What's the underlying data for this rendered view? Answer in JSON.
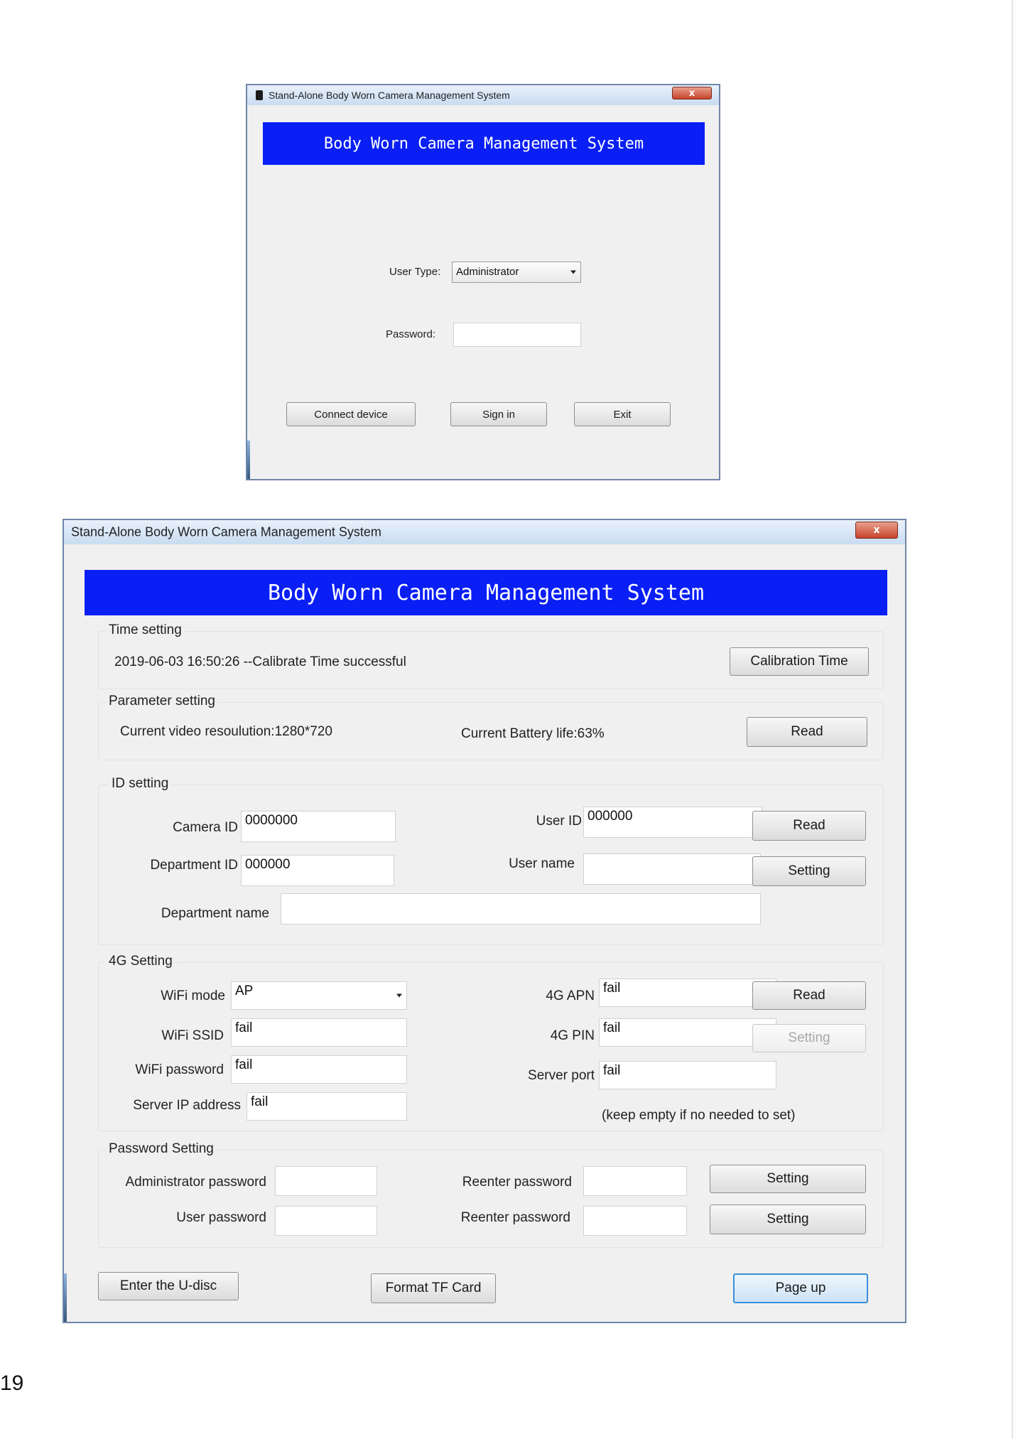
{
  "login": {
    "window_title": "Stand-Alone Body Worn Camera Management System",
    "close_glyph": "x",
    "banner": "Body Worn Camera Management System",
    "user_type_label": "User Type:",
    "user_type_value": "Administrator",
    "password_label": "Password:",
    "password_value": "",
    "connect_label": "Connect device",
    "sign_in_label": "Sign in",
    "exit_label": "Exit"
  },
  "main": {
    "window_title": "Stand-Alone Body Worn Camera Management System",
    "close_glyph": "x",
    "banner": "Body Worn Camera Management System",
    "time_setting": {
      "title": "Time setting",
      "status": "2019-06-03 16:50:26 --Calibrate Time successful",
      "button": "Calibration Time"
    },
    "parameter_setting": {
      "title": "Parameter setting",
      "resolution": "Current video resoulution:1280*720",
      "battery": "Current Battery life:63%",
      "read_button": "Read"
    },
    "id_setting": {
      "title": "ID setting",
      "camera_id_label": "Camera ID",
      "camera_id_value": "0000000",
      "user_id_label": "User ID",
      "user_id_value": "000000",
      "department_id_label": "Department ID",
      "department_id_value": "000000",
      "user_name_label": "User name",
      "user_name_value": "",
      "department_name_label": "Department name",
      "department_name_value": "",
      "read_button": "Read",
      "setting_button": "Setting"
    },
    "g4_setting": {
      "title": "4G Setting",
      "wifi_mode_label": "WiFi mode",
      "wifi_mode_value": "AP",
      "wifi_ssid_label": "WiFi SSID",
      "wifi_ssid_value": "fail",
      "wifi_password_label": "WiFi password",
      "wifi_password_value": "fail",
      "server_ip_label": "Server IP address",
      "server_ip_value": "fail",
      "apn_label": "4G APN",
      "apn_value": "fail",
      "pin_label": "4G PIN",
      "pin_value": "fail",
      "server_port_label": "Server port",
      "server_port_value": "fail",
      "note": "(keep empty if no needed to set)",
      "read_button": "Read",
      "setting_button": "Setting"
    },
    "password_setting": {
      "title": "Password Setting",
      "admin_label": "Administrator password",
      "user_label": "User password",
      "reenter_label": "Reenter password",
      "setting_button": "Setting"
    },
    "footer": {
      "udisc_button": "Enter the U-disc",
      "format_button": "Format TF Card",
      "page_up_button": "Page up"
    }
  },
  "page_number": "19"
}
